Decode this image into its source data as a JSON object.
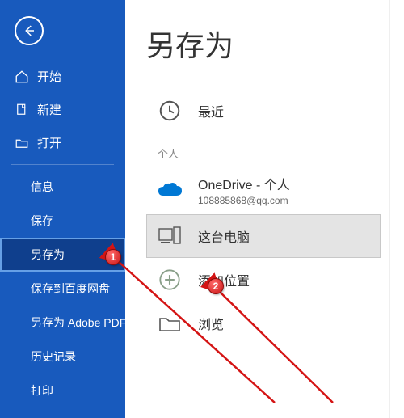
{
  "page_title": "另存为",
  "sidebar": {
    "top_nav": [
      {
        "label": "开始",
        "icon": "home-icon"
      },
      {
        "label": "新建",
        "icon": "new-icon"
      },
      {
        "label": "打开",
        "icon": "open-icon"
      }
    ],
    "sub_nav": [
      {
        "label": "信息",
        "selected": false
      },
      {
        "label": "保存",
        "selected": false
      },
      {
        "label": "另存为",
        "selected": true
      },
      {
        "label": "保存到百度网盘",
        "selected": false
      },
      {
        "label": "另存为 Adobe PDF",
        "selected": false
      },
      {
        "label": "历史记录",
        "selected": false
      },
      {
        "label": "打印",
        "selected": false
      }
    ]
  },
  "locations": {
    "recent_label": "最近",
    "section_personal": "个人",
    "onedrive": {
      "title": "OneDrive - 个人",
      "subtitle": "108885868@qq.com"
    },
    "this_pc": "这台电脑",
    "add_location": "添加位置",
    "browse": "浏览"
  },
  "callouts": {
    "one": "1",
    "two": "2"
  }
}
